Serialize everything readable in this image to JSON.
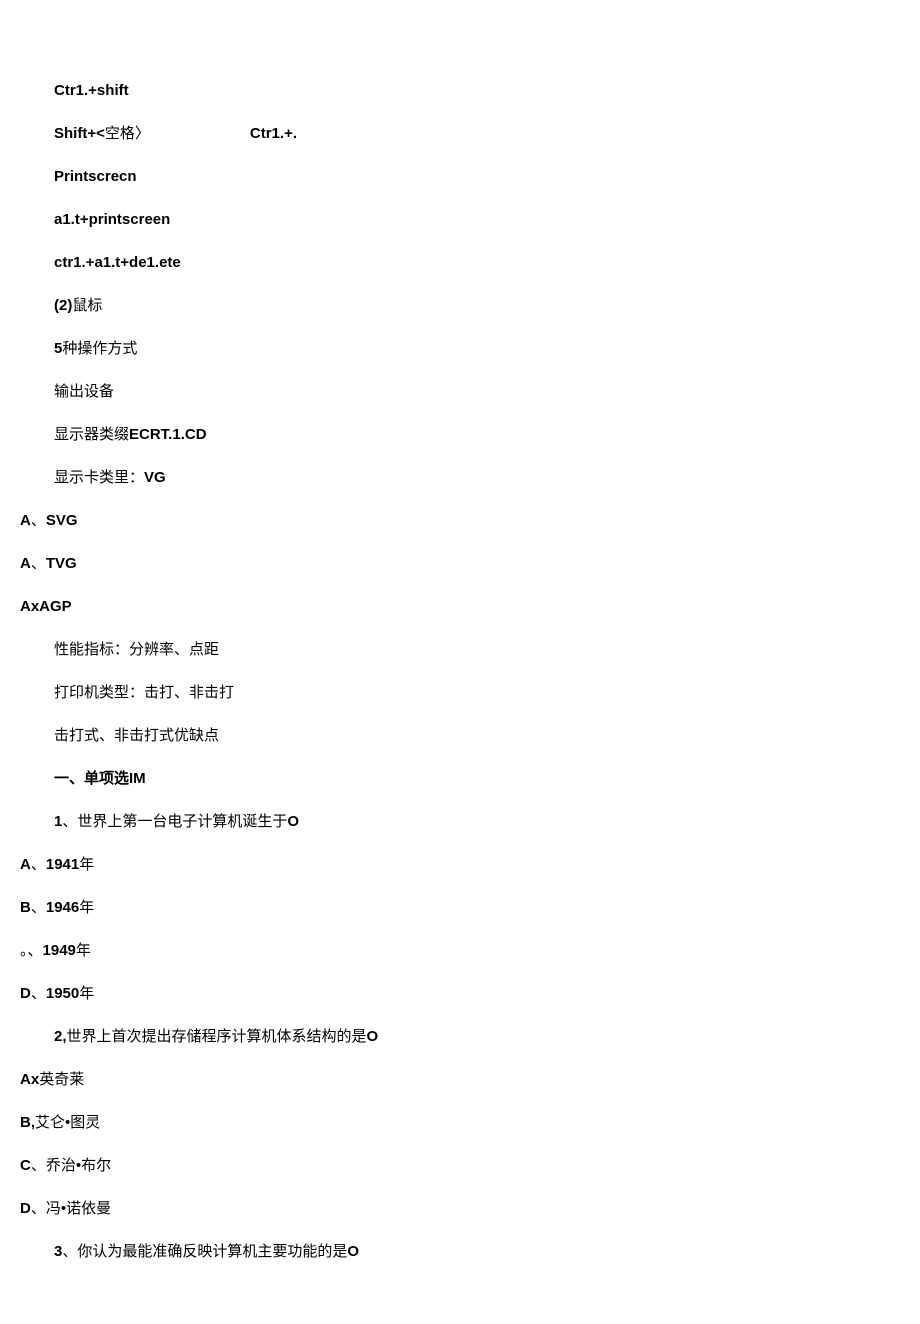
{
  "lines": [
    {
      "indent": "indent1",
      "parts": [
        {
          "text": "Ctr1.+shift",
          "bold": true
        }
      ]
    },
    {
      "indent": "indent1",
      "parts": [
        {
          "text": "Shift+<",
          "bold": true
        },
        {
          "text": "空格",
          "bold": false
        },
        {
          "text": "〉",
          "bold": false
        },
        {
          "text": "",
          "bold": false,
          "gap": true
        },
        {
          "text": "Ctr1.+.",
          "bold": true
        }
      ]
    },
    {
      "indent": "indent1",
      "parts": [
        {
          "text": "Printscrecn",
          "bold": true
        }
      ]
    },
    {
      "indent": "indent1",
      "parts": [
        {
          "text": "a1.t+printscreen",
          "bold": true
        }
      ]
    },
    {
      "indent": "indent1",
      "parts": [
        {
          "text": "ctr1.+a1.t+de1.ete",
          "bold": true
        }
      ]
    },
    {
      "indent": "indent1",
      "parts": [
        {
          "text": "(2)",
          "bold": true
        },
        {
          "text": "鼠标",
          "bold": false
        }
      ]
    },
    {
      "indent": "indent1",
      "parts": [
        {
          "text": "5",
          "bold": true
        },
        {
          "text": "种操作方式",
          "bold": false
        }
      ]
    },
    {
      "indent": "indent1",
      "parts": [
        {
          "text": "输出设备",
          "bold": false
        }
      ]
    },
    {
      "indent": "indent1",
      "parts": [
        {
          "text": "显示器类缀",
          "bold": false
        },
        {
          "text": "ECRT.1.CD",
          "bold": true
        }
      ]
    },
    {
      "indent": "indent1",
      "parts": [
        {
          "text": "显示卡类里：",
          "bold": false
        },
        {
          "text": "VG",
          "bold": true
        }
      ]
    },
    {
      "indent": "indent0",
      "parts": [
        {
          "text": "A",
          "bold": true
        },
        {
          "text": "、",
          "bold": false
        },
        {
          "text": "SVG",
          "bold": true
        }
      ]
    },
    {
      "indent": "indent0",
      "parts": [
        {
          "text": "A",
          "bold": true
        },
        {
          "text": "、",
          "bold": false
        },
        {
          "text": "TVG",
          "bold": true
        }
      ]
    },
    {
      "indent": "indent0",
      "parts": [
        {
          "text": "AxAGP",
          "bold": true
        }
      ]
    },
    {
      "indent": "indent1",
      "parts": [
        {
          "text": "性能指标：分辨率、点距",
          "bold": false
        }
      ]
    },
    {
      "indent": "indent1",
      "parts": [
        {
          "text": "打印机类型：击打、非击打",
          "bold": false
        }
      ]
    },
    {
      "indent": "indent1",
      "parts": [
        {
          "text": "击打式、非击打式优缺点",
          "bold": false
        }
      ]
    },
    {
      "indent": "indent1",
      "parts": [
        {
          "text": "一、单项选",
          "bold": true
        },
        {
          "text": "IM",
          "bold": true
        }
      ]
    },
    {
      "indent": "indent1",
      "parts": [
        {
          "text": "1",
          "bold": true
        },
        {
          "text": "、世界上第一台电子计算机诞生于",
          "bold": false
        },
        {
          "text": "O",
          "bold": true
        }
      ]
    },
    {
      "indent": "indent0",
      "parts": [
        {
          "text": "A",
          "bold": true
        },
        {
          "text": "、 ",
          "bold": false
        },
        {
          "text": "1941",
          "bold": true
        },
        {
          "text": "年",
          "bold": false
        }
      ]
    },
    {
      "indent": "indent0",
      "parts": [
        {
          "text": "B",
          "bold": true
        },
        {
          "text": "、 ",
          "bold": false
        },
        {
          "text": "1946",
          "bold": true
        },
        {
          "text": "年",
          "bold": false
        }
      ]
    },
    {
      "indent": "indent0",
      "parts": [
        {
          "text": "。、",
          "bold": false
        },
        {
          "text": "1949",
          "bold": true
        },
        {
          "text": "年",
          "bold": false
        }
      ]
    },
    {
      "indent": "indent0",
      "parts": [
        {
          "text": "D",
          "bold": true
        },
        {
          "text": "、",
          "bold": false
        },
        {
          "text": "1950",
          "bold": true
        },
        {
          "text": "年",
          "bold": false
        }
      ]
    },
    {
      "indent": "indent1",
      "parts": [
        {
          "text": "2,",
          "bold": true
        },
        {
          "text": "世界上首次提出存储程序计算机体系结构的是",
          "bold": false
        },
        {
          "text": "O",
          "bold": true
        }
      ]
    },
    {
      "indent": "indent0",
      "parts": [
        {
          "text": "Ax",
          "bold": true
        },
        {
          "text": "英奇莱",
          "bold": false
        }
      ]
    },
    {
      "indent": "indent0",
      "parts": [
        {
          "text": "B,",
          "bold": true
        },
        {
          "text": "艾仑•图灵",
          "bold": false
        }
      ]
    },
    {
      "indent": "indent0",
      "parts": [
        {
          "text": "C",
          "bold": true
        },
        {
          "text": "、乔治•布尔",
          "bold": false
        }
      ]
    },
    {
      "indent": "indent0",
      "parts": [
        {
          "text": "D",
          "bold": true
        },
        {
          "text": "、冯•诺依曼",
          "bold": false
        }
      ]
    },
    {
      "indent": "indent1",
      "parts": [
        {
          "text": "3",
          "bold": true
        },
        {
          "text": "、你认为最能准确反映计算机主要功能的是",
          "bold": false
        },
        {
          "text": "O",
          "bold": true
        }
      ]
    }
  ]
}
